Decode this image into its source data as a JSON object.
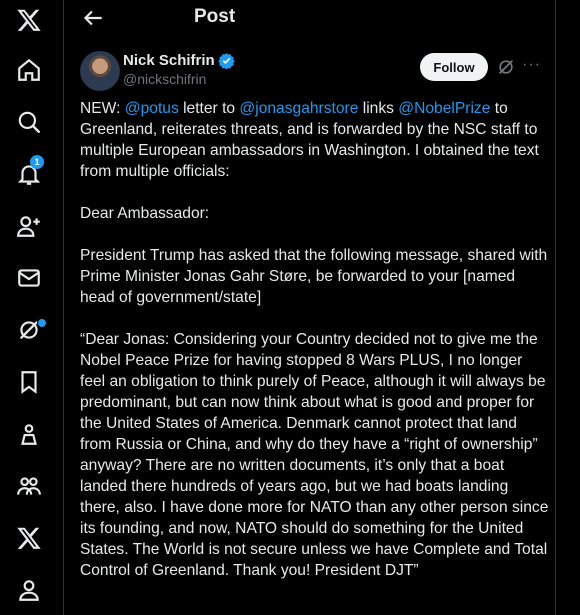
{
  "nav": {
    "notification_count": "1"
  },
  "header": {
    "title": "Post"
  },
  "author": {
    "name": "Nick Schifrin",
    "handle": "@nickschifrin"
  },
  "actions": {
    "follow_label": "Follow",
    "more_label": "···"
  },
  "post": {
    "p1_a": "NEW: ",
    "mention_1": "@potus",
    "p1_b": " letter to ",
    "mention_2": "@jonasgahrstore",
    "p1_c": " links ",
    "mention_3": "@NobelPrize",
    "p1_d": " to Greenland, reiterates threats, and is forwarded by the NSC staff to multiple European ambassadors in Washington. I obtained the text from multiple officials:",
    "p2": "Dear Ambassador:",
    "p3": "President Trump has asked that the following message, shared with Prime Minister Jonas Gahr Støre, be forwarded to your [named head of government/state]",
    "p4": "“Dear Jonas: Considering your Country decided not to give me the Nobel Peace Prize for having stopped 8 Wars PLUS, I no longer feel an obligation to think purely of Peace, although it will always be predominant, but can now think about what is good and proper for the United States of America. Denmark cannot protect that land from Russia or China, and why do they have a “right of ownership” anyway? There are no written documents, it’s only that a boat landed there hundreds of years ago, but we had boats landing there, also. I have done more for NATO than any other person since its founding, and now, NATO should do something for the United States. The World is not secure unless we have Complete and Total Control of Greenland. Thank you! President DJT”"
  },
  "colors": {
    "accent": "#1d9bf0",
    "text": "#e7e9ea",
    "muted": "#71767b",
    "border": "#2f3336"
  }
}
